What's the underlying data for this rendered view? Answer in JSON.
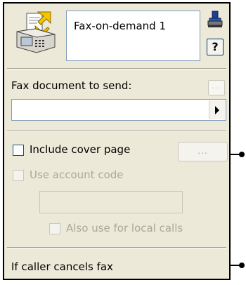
{
  "header": {
    "name_value": "Fax-on-demand 1",
    "help_label": "?"
  },
  "fax_document": {
    "label": "Fax document to send:",
    "browse_label": "...",
    "value": ""
  },
  "cover_page": {
    "label": "Include cover page",
    "checked": false,
    "button_label": "..."
  },
  "account_code": {
    "label": "Use account code",
    "checked": false,
    "enabled": false,
    "value": ""
  },
  "local_calls": {
    "label": "Also use for local calls",
    "checked": false,
    "enabled": false
  },
  "cancel_exit": {
    "label": "If caller cancels fax"
  },
  "icons": [
    "fax-document-icon",
    "stamp-icon",
    "browse-icon",
    "dropdown-arrow-icon"
  ],
  "colors": {
    "panel_bg": "#ece9d8",
    "input_border": "#7f9db9",
    "disabled_text": "#aca899"
  }
}
